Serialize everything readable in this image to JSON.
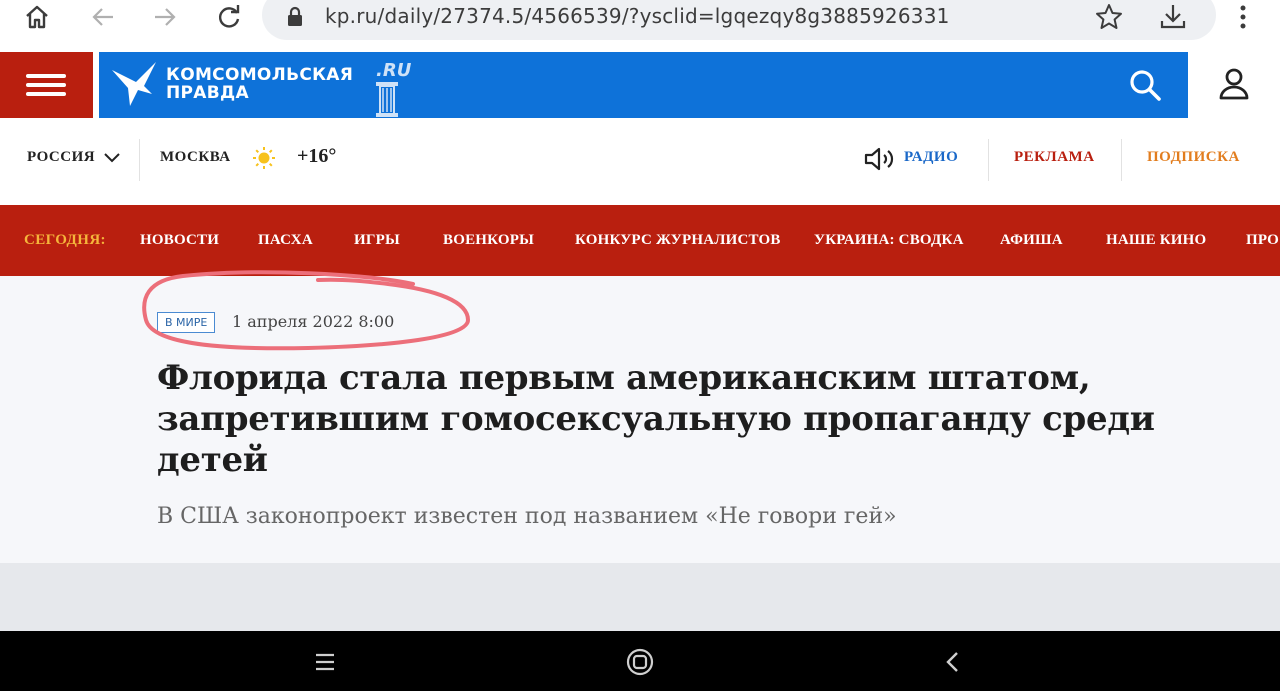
{
  "browser": {
    "url": "kp.ru/daily/27374.5/4566539/?ysclid=lgqezqy8g3885926331"
  },
  "header": {
    "logo_line1": "Комсомольская",
    "logo_line2": "правда",
    "logo_ru": ".RU",
    "brand_blue": "#0e72d9",
    "brand_red": "#b91f0f"
  },
  "info": {
    "region": "РОССИЯ",
    "city": "МОСКВА",
    "temperature": "+16°",
    "radio": "РАДИО",
    "ads": "РЕКЛАМА",
    "subscribe": "ПОДПИСКА"
  },
  "menu": {
    "today": "СЕГОДНЯ:",
    "items": [
      "НОВОСТИ",
      "ПАСХА",
      "ИГРЫ",
      "ВОЕНКОРЫ",
      "КОНКУРС ЖУРНАЛИСТОВ",
      "УКРАИНА: СВОДКА",
      "АФИША",
      "НАШЕ КИНО",
      "ПРО"
    ]
  },
  "article": {
    "tag": "В МИРЕ",
    "date": "1 апреля 2022 8:00",
    "headline": "Флорида стала первым американским штатом, запретившим гомосексуальную пропаганду среди детей",
    "lead": "В США законопроект известен под названием «Не говори гей»"
  },
  "icons": {
    "home": "home-icon",
    "back": "arrow-left-icon",
    "forward": "arrow-right-icon",
    "reload": "reload-icon",
    "lock": "lock-icon",
    "bookmark": "star-icon",
    "download": "download-icon",
    "more": "kebab-menu-icon",
    "search": "search-icon",
    "user": "user-icon",
    "sun": "sun-icon",
    "speaker": "speaker-icon"
  }
}
